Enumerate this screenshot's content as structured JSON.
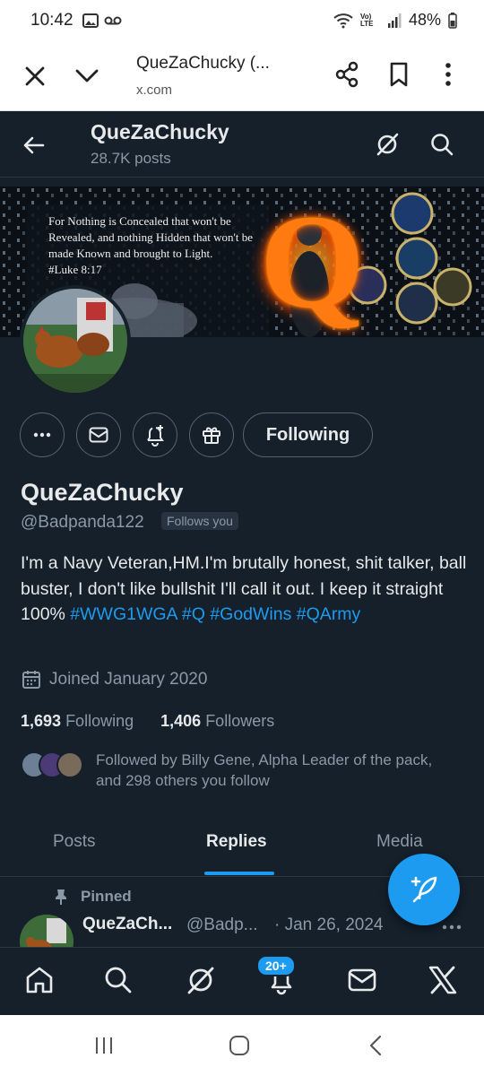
{
  "status_bar": {
    "time": "10:42",
    "battery": "48%",
    "network_label": "Vo) LTE"
  },
  "browser": {
    "title": "QueZaChucky (...",
    "url": "x.com"
  },
  "header": {
    "name": "QueZaChucky",
    "posts_count": "28.7K posts"
  },
  "banner": {
    "quote": "For Nothing is Concealed that won't be Revealed, and nothing Hidden that won't be made Known and brought to Light.",
    "verse": "#Luke 8:17",
    "letter": "Q"
  },
  "actions": {
    "following_label": "Following"
  },
  "profile": {
    "display_name": "QueZaChucky",
    "handle": "@Badpanda122",
    "follows_you": "Follows you",
    "bio_text": "I'm a Navy Veteran,HM.I'm brutally honest, shit talker, ball buster, I don't like bullshit I'll call it out. I keep it straight 100%",
    "hashtags": [
      "#WWG1WGA",
      "#Q",
      "#GodWins",
      "#QArmy"
    ],
    "joined": "Joined January 2020",
    "following_count": "1,693",
    "following_label": "Following",
    "followers_count": "1,406",
    "followers_label": "Followers",
    "followed_by": "Followed by Billy Gene, Alpha Leader of the pack, and 298 others you follow"
  },
  "tabs": [
    {
      "label": "Posts",
      "active": false
    },
    {
      "label": "Replies",
      "active": true
    },
    {
      "label": "Media",
      "active": false
    }
  ],
  "pinned_post": {
    "pinned_label": "Pinned",
    "author": "QueZaCh...",
    "handle": "@Badp...",
    "date": "· Jan 26, 2024"
  },
  "bottom_nav": {
    "notifications_badge": "20+",
    "items": [
      "home-icon",
      "search-icon",
      "grok-icon",
      "notifications-icon",
      "messages-icon",
      "x-logo-icon"
    ]
  },
  "colors": {
    "background": "#15202b",
    "accent": "#1d9bf0",
    "text": "#e7e9ea",
    "muted": "#8b98a5"
  }
}
